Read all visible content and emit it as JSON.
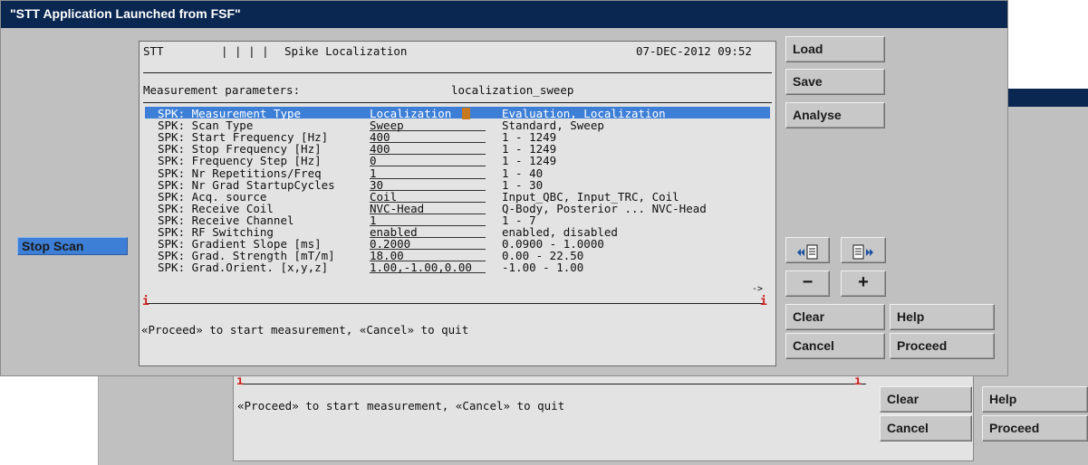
{
  "window": {
    "title": "\"STT Application Launched from FSF\""
  },
  "left_panel": {
    "stop_scan_label": "Stop Scan"
  },
  "header": {
    "app": "STT",
    "separators": "| | | |",
    "section": "Spike Localization",
    "datetime": "07-DEC-2012 09:52"
  },
  "params": {
    "heading": "Measurement parameters:",
    "name": "localization_sweep",
    "rows": [
      {
        "label": "SPK: Measurement Type",
        "value": "Localization",
        "range": "Evaluation, Localization"
      },
      {
        "label": "SPK: Scan Type",
        "value": "Sweep",
        "range": "Standard, Sweep"
      },
      {
        "label": "SPK: Start Frequency [Hz]",
        "value": "400",
        "range": "1 - 1249"
      },
      {
        "label": "SPK: Stop Frequency [Hz]",
        "value": "400",
        "range": "1 - 1249"
      },
      {
        "label": "SPK: Frequency Step [Hz]",
        "value": "0",
        "range": "1 - 1249"
      },
      {
        "label": "SPK: Nr Repetitions/Freq",
        "value": "1",
        "range": "1 - 40"
      },
      {
        "label": "SPK: Nr Grad StartupCycles",
        "value": "30",
        "range": "1 - 30"
      },
      {
        "label": "SPK: Acq. source",
        "value": "Coil",
        "range": "Input_QBC, Input_TRC, Coil"
      },
      {
        "label": "SPK: Receive Coil",
        "value": "NVC-Head",
        "range": "Q-Body, Posterior ... NVC-Head"
      },
      {
        "label": "SPK: Receive Channel",
        "value": "1",
        "range": "1 - 7"
      },
      {
        "label": "SPK: RF Switching",
        "value": "enabled",
        "range": "enabled, disabled"
      },
      {
        "label": "SPK: Gradient Slope [ms]",
        "value": "0.2000",
        "range": "0.0900 - 1.0000"
      },
      {
        "label": "SPK: Grad. Strength [mT/m]",
        "value": "18.00",
        "range": "0.00 - 22.50"
      },
      {
        "label": "SPK: Grad.Orient. [x,y,z]",
        "value": "1.00,-1.00,0.00",
        "range": "-1.00 - 1.00"
      }
    ],
    "more_arrow": "->"
  },
  "marker": "i",
  "message": "«Proceed» to start measurement, «Cancel» to quit",
  "buttons": {
    "load": "Load",
    "save": "Save",
    "analyse": "Analyse",
    "minus": "−",
    "plus": "+",
    "clear": "Clear",
    "help": "Help",
    "cancel": "Cancel",
    "proceed": "Proceed"
  },
  "icons": {
    "prev": "page-prev-icon",
    "next": "page-next-icon"
  },
  "background_window": {
    "message": "«Proceed» to start measurement, «Cancel» to quit",
    "clear": "Clear",
    "help": "Help",
    "cancel": "Cancel",
    "proceed": "Proceed"
  },
  "colors": {
    "titlebar": "#0a2752",
    "selection": "#3d7fd6",
    "panel": "#c0c0c0",
    "marker": "#cc1f1f"
  }
}
